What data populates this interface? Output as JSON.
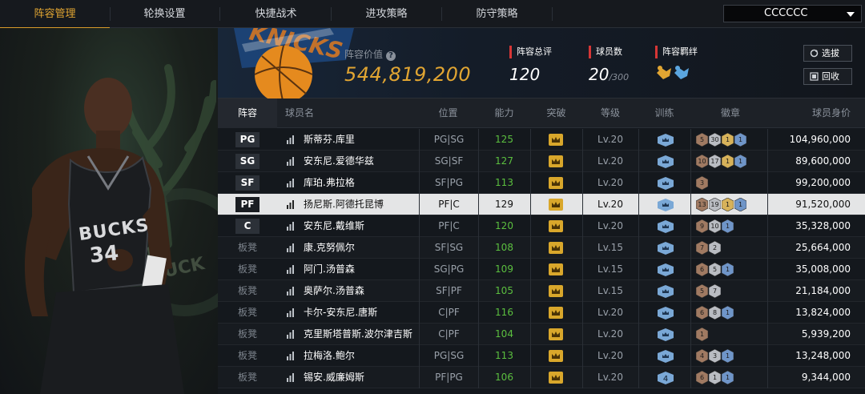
{
  "tabs": [
    {
      "label": "阵容管理",
      "active": true
    },
    {
      "label": "轮换设置",
      "active": false
    },
    {
      "label": "快捷战术",
      "active": false
    },
    {
      "label": "进攻策略",
      "active": false
    },
    {
      "label": "防守策略",
      "active": false
    }
  ],
  "team_select": {
    "value": "CCCCCC"
  },
  "summary": {
    "value_label": "阵容价值",
    "value": "544,819,200",
    "rating_label": "阵容总评",
    "rating": "120",
    "players_label": "球员数",
    "players_count": "20",
    "players_max": "/300",
    "bond_label": "阵容羁绊",
    "select_button": "选拔",
    "recycle_button": "回收"
  },
  "headers": {
    "lineup": "阵容",
    "name": "球员名",
    "position": "位置",
    "ability": "能力",
    "breakthrough": "突破",
    "level": "等级",
    "training": "训练",
    "badges": "徽章",
    "value": "球员身价"
  },
  "rows": [
    {
      "slot": "PG",
      "starter": true,
      "name": "斯蒂芬.库里",
      "position": "PG|SG",
      "ability": "125",
      "level": "Lv.20",
      "training": "",
      "badges": [
        {
          "t": "bronze",
          "n": "5"
        },
        {
          "t": "silver",
          "n": "30"
        },
        {
          "t": "gold",
          "n": "1"
        },
        {
          "t": "blue",
          "n": "1"
        }
      ],
      "value": "104,960,000",
      "selected": false
    },
    {
      "slot": "SG",
      "starter": true,
      "name": "安东尼.爱德华兹",
      "position": "SG|SF",
      "ability": "127",
      "level": "Lv.20",
      "training": "",
      "badges": [
        {
          "t": "bronze",
          "n": "10"
        },
        {
          "t": "silver",
          "n": "17"
        },
        {
          "t": "gold",
          "n": "1"
        },
        {
          "t": "blue",
          "n": "1"
        }
      ],
      "value": "89,600,000",
      "selected": false
    },
    {
      "slot": "SF",
      "starter": true,
      "name": "库珀.弗拉格",
      "position": "SF|PG",
      "ability": "113",
      "level": "Lv.20",
      "training": "",
      "badges": [
        {
          "t": "bronze",
          "n": "3"
        }
      ],
      "value": "99,200,000",
      "selected": false
    },
    {
      "slot": "PF",
      "starter": true,
      "name": "扬尼斯.阿德托昆博",
      "position": "PF|C",
      "ability": "129",
      "level": "Lv.20",
      "training": "",
      "badges": [
        {
          "t": "bronze",
          "n": "13"
        },
        {
          "t": "silver",
          "n": "19"
        },
        {
          "t": "gold",
          "n": "1"
        },
        {
          "t": "blue",
          "n": "1"
        }
      ],
      "value": "91,520,000",
      "selected": true
    },
    {
      "slot": "C",
      "starter": true,
      "name": "安东尼.戴维斯",
      "position": "PF|C",
      "ability": "120",
      "level": "Lv.20",
      "training": "",
      "badges": [
        {
          "t": "bronze",
          "n": "9"
        },
        {
          "t": "silver",
          "n": "10"
        },
        {
          "t": "blue",
          "n": "1"
        }
      ],
      "value": "35,328,000",
      "selected": false
    },
    {
      "slot": "板凳",
      "starter": false,
      "name": "康.克努佩尔",
      "position": "SF|SG",
      "ability": "108",
      "level": "Lv.15",
      "training": "",
      "badges": [
        {
          "t": "bronze",
          "n": "7"
        },
        {
          "t": "silver",
          "n": "2"
        }
      ],
      "value": "25,664,000",
      "selected": false
    },
    {
      "slot": "板凳",
      "starter": false,
      "name": "阿门.汤普森",
      "position": "SG|PG",
      "ability": "109",
      "level": "Lv.15",
      "training": "",
      "badges": [
        {
          "t": "bronze",
          "n": "6"
        },
        {
          "t": "silver",
          "n": "5"
        },
        {
          "t": "blue",
          "n": "1"
        }
      ],
      "value": "35,008,000",
      "selected": false
    },
    {
      "slot": "板凳",
      "starter": false,
      "name": "奥萨尔.汤普森",
      "position": "SF|PF",
      "ability": "105",
      "level": "Lv.15",
      "training": "",
      "badges": [
        {
          "t": "bronze",
          "n": "5"
        },
        {
          "t": "silver",
          "n": "7"
        }
      ],
      "value": "21,184,000",
      "selected": false
    },
    {
      "slot": "板凳",
      "starter": false,
      "name": "卡尔-安东尼.唐斯",
      "position": "C|PF",
      "ability": "116",
      "level": "Lv.20",
      "training": "",
      "badges": [
        {
          "t": "bronze",
          "n": "6"
        },
        {
          "t": "silver",
          "n": "8"
        },
        {
          "t": "blue",
          "n": "1"
        }
      ],
      "value": "13,824,000",
      "selected": false
    },
    {
      "slot": "板凳",
      "starter": false,
      "name": "克里斯塔普斯.波尔津吉斯",
      "position": "C|PF",
      "ability": "104",
      "level": "Lv.20",
      "training": "",
      "badges": [
        {
          "t": "bronze",
          "n": "1"
        }
      ],
      "value": "5,939,200",
      "selected": false
    },
    {
      "slot": "板凳",
      "starter": false,
      "name": "拉梅洛.鲍尔",
      "position": "PG|SG",
      "ability": "113",
      "level": "Lv.20",
      "training": "",
      "badges": [
        {
          "t": "bronze",
          "n": "4"
        },
        {
          "t": "silver",
          "n": "3"
        },
        {
          "t": "blue",
          "n": "1"
        }
      ],
      "value": "13,248,000",
      "selected": false
    },
    {
      "slot": "板凳",
      "starter": false,
      "name": "锡安.威廉姆斯",
      "position": "PF|PG",
      "ability": "106",
      "level": "Lv.20",
      "training": "4",
      "badges": [
        {
          "t": "bronze",
          "n": "6"
        },
        {
          "t": "silver",
          "n": "1"
        },
        {
          "t": "blue",
          "n": "1"
        }
      ],
      "value": "9,344,000",
      "selected": false
    }
  ],
  "portrait": {
    "jersey_text": "BUCKS",
    "jersey_number": "34",
    "wall_text": "E BUCK"
  },
  "colors": {
    "accent": "#e1a532",
    "ability_green": "#5bbf3f",
    "stat_marker": "#d63636",
    "selected_row": "#e4e5e6"
  }
}
